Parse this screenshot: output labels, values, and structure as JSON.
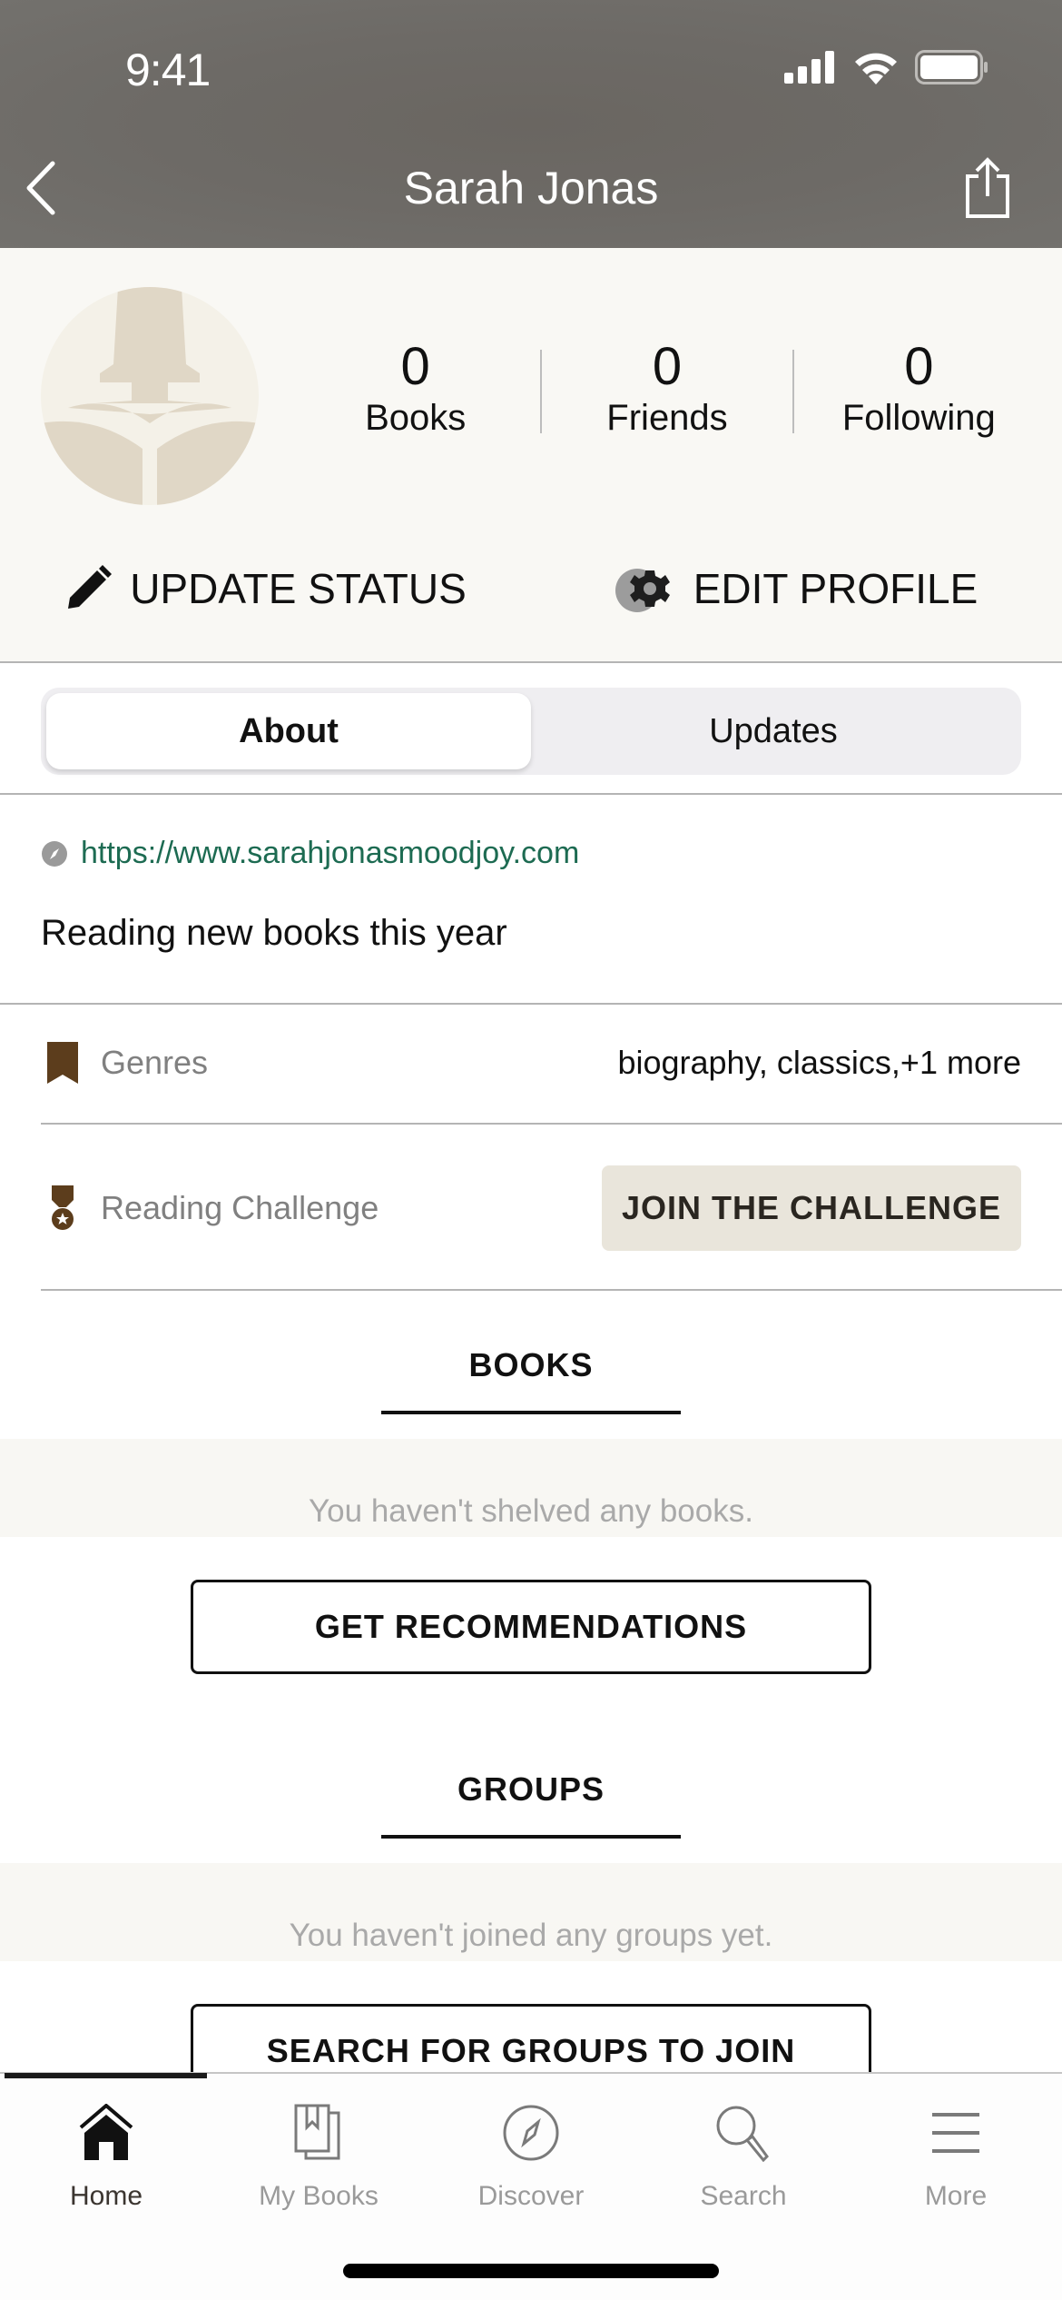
{
  "status_bar": {
    "time": "9:41",
    "icons": [
      "signal-icon",
      "wifi-icon",
      "battery-icon"
    ]
  },
  "nav": {
    "title": "Sarah Jonas",
    "back_icon": "chevron-left-icon",
    "share_icon": "share-icon"
  },
  "profile": {
    "avatar_icon": "reader-silhouette-icon",
    "stats": [
      {
        "value": "0",
        "label": "Books"
      },
      {
        "value": "0",
        "label": "Friends"
      },
      {
        "value": "0",
        "label": "Following"
      }
    ],
    "actions": {
      "update_status": "UPDATE STATUS",
      "edit_profile": "EDIT PROFILE"
    }
  },
  "segments": {
    "items": [
      "About",
      "Updates"
    ],
    "active": "About"
  },
  "about": {
    "website": "https://www.sarahjonasmoodjoy.com",
    "bio": "Reading new books this year",
    "genres_label": "Genres",
    "genres_value": "biography, classics,+1 more",
    "challenge_label": "Reading Challenge",
    "challenge_button": "JOIN THE CHALLENGE"
  },
  "books_section": {
    "title": "BOOKS",
    "empty_text": "You haven't shelved any books.",
    "button": "GET RECOMMENDATIONS"
  },
  "groups_section": {
    "title": "GROUPS",
    "empty_text": "You haven't joined any groups yet.",
    "button": "SEARCH FOR GROUPS TO JOIN"
  },
  "tabbar": {
    "items": [
      {
        "label": "Home",
        "icon": "home-icon",
        "active": true
      },
      {
        "label": "My Books",
        "icon": "my-books-icon",
        "active": false
      },
      {
        "label": "Discover",
        "icon": "compass-icon",
        "active": false
      },
      {
        "label": "Search",
        "icon": "search-icon",
        "active": false
      },
      {
        "label": "More",
        "icon": "menu-icon",
        "active": false
      }
    ]
  },
  "colors": {
    "link": "#1d6b52",
    "accent_brown": "#5c3d1c",
    "profile_bg": "#f9f8f4",
    "challenge_button_bg": "#e9e5db",
    "header_bg": "#6d6a66"
  }
}
